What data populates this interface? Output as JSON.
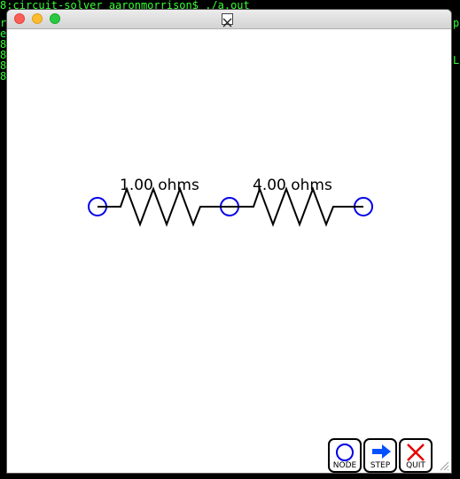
{
  "terminal": {
    "prompt_line": "8:circuit-solver aaronmorrison$ ./a.out",
    "left_fragments": [
      "r",
      "e",
      "8",
      "8",
      "8",
      "8"
    ],
    "right_fragments": [
      "p",
      "L"
    ]
  },
  "window": {
    "title_icon": "X11-icon",
    "colors": {
      "node": "#0000e6",
      "wire": "#000000",
      "step_arrow": "#0050ff",
      "quit_x": "#e60000"
    }
  },
  "circuit": {
    "resistors": [
      {
        "label": "1.00 ohms"
      },
      {
        "label": "4.00 ohms"
      }
    ],
    "nodes": [
      "node-left",
      "node-middle",
      "node-right"
    ]
  },
  "toolbar": {
    "node_label": "NODE",
    "step_label": "STEP",
    "quit_label": "QUIT"
  }
}
